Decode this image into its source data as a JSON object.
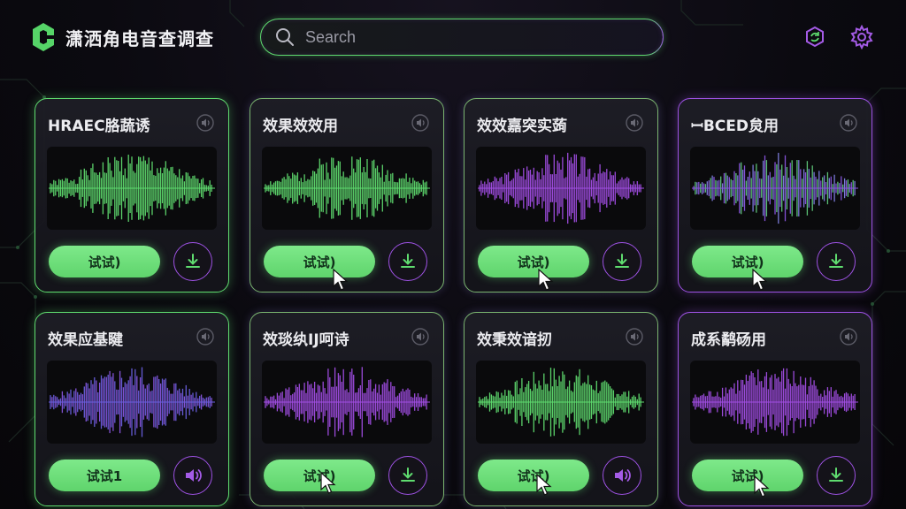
{
  "header": {
    "app_title": "潇洒角电音查调查",
    "logo_icon": "hexagon-logo-icon",
    "search_placeholder": "Search",
    "search_icon": "search-icon",
    "right_icons": [
      "hexagon-sync-icon",
      "gear-icon"
    ]
  },
  "colors": {
    "accent_green": "#5fdc6f",
    "accent_purple": "#9e52e4",
    "background": "#0b0a10"
  },
  "cards": [
    {
      "title": "HRAEC胳蔬诱",
      "button": "试试)",
      "action_icon": "download-icon",
      "wave": "green"
    },
    {
      "title": "效果效效用",
      "button": "试试)",
      "action_icon": "download-icon",
      "wave": "green"
    },
    {
      "title": "效效嘉突实蒟",
      "button": "试试)",
      "action_icon": "download-icon",
      "wave": "purple"
    },
    {
      "title": "ꟷBCED炱用",
      "button": "试试)",
      "action_icon": "download-icon",
      "wave": "mixed"
    },
    {
      "title": "效果应基睷",
      "button": "试试1",
      "action_icon": "speaker-icon",
      "wave": "blue-purple"
    },
    {
      "title": "效琰纨IJ呵诗",
      "button": "试试)",
      "action_icon": "download-icon",
      "wave": "purple"
    },
    {
      "title": "效秉效谙扨",
      "button": "试试)",
      "action_icon": "speaker-icon",
      "wave": "green"
    },
    {
      "title": "成系鹬砀用",
      "button": "试试)",
      "action_icon": "download-icon",
      "wave": "purple"
    }
  ]
}
